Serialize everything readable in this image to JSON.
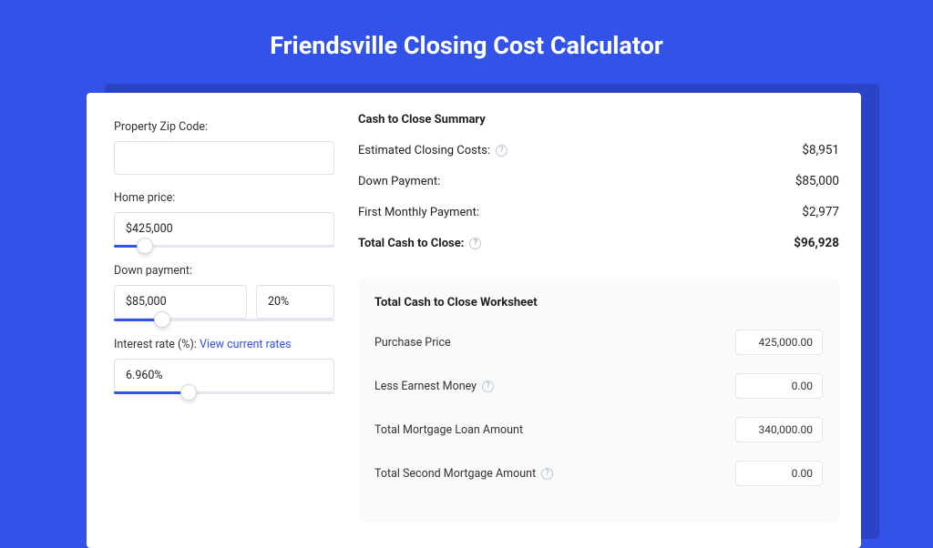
{
  "header": {
    "title": "Friendsville Closing Cost Calculator"
  },
  "inputs": {
    "zip": {
      "label": "Property Zip Code:",
      "value": ""
    },
    "home_price": {
      "label": "Home price:",
      "value": "$425,000",
      "slider_pct": 14
    },
    "down_payment": {
      "label": "Down payment:",
      "value": "$85,000",
      "pct_value": "20%",
      "slider_pct": 22
    },
    "interest_rate": {
      "label": "Interest rate (%):",
      "link_text": "View current rates",
      "value": "6.960%",
      "slider_pct": 34
    }
  },
  "summary": {
    "title": "Cash to Close Summary",
    "rows": [
      {
        "label": "Estimated Closing Costs:",
        "help": true,
        "value": "$8,951",
        "bold": false
      },
      {
        "label": "Down Payment:",
        "help": false,
        "value": "$85,000",
        "bold": false
      },
      {
        "label": "First Monthly Payment:",
        "help": false,
        "value": "$2,977",
        "bold": false
      },
      {
        "label": "Total Cash to Close:",
        "help": true,
        "value": "$96,928",
        "bold": true
      }
    ]
  },
  "worksheet": {
    "title": "Total Cash to Close Worksheet",
    "rows": [
      {
        "label": "Purchase Price",
        "help": false,
        "value": "425,000.00"
      },
      {
        "label": "Less Earnest Money",
        "help": true,
        "value": "0.00"
      },
      {
        "label": "Total Mortgage Loan Amount",
        "help": false,
        "value": "340,000.00"
      },
      {
        "label": "Total Second Mortgage Amount",
        "help": true,
        "value": "0.00"
      }
    ]
  }
}
